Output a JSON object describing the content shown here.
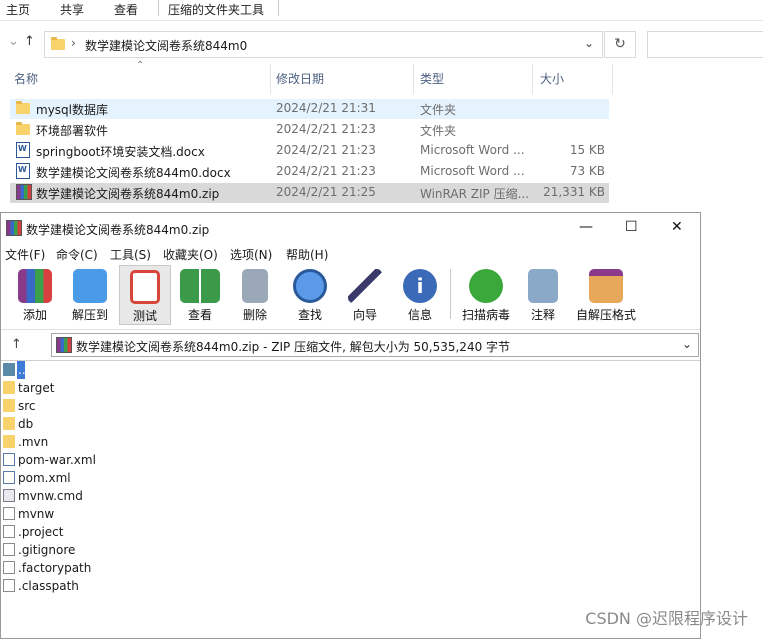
{
  "explorer": {
    "ribbon_tabs": [
      "主页",
      "共享",
      "查看",
      "压缩的文件夹工具"
    ],
    "breadcrumb": "数学建模论文阅卷系统844m0",
    "columns": {
      "name": "名称",
      "date": "修改日期",
      "type": "类型",
      "size": "大小"
    },
    "files": [
      {
        "name": "mysql数据库",
        "date": "2024/2/21 21:31",
        "type": "文件夹",
        "size": "",
        "icon": "folder-icon"
      },
      {
        "name": "环境部署软件",
        "date": "2024/2/21 21:23",
        "type": "文件夹",
        "size": "",
        "icon": "folder-icon"
      },
      {
        "name": "springboot环境安装文档.docx",
        "date": "2024/2/21 21:23",
        "type": "Microsoft Word ...",
        "size": "15 KB",
        "icon": "word-icon"
      },
      {
        "name": "数学建模论文阅卷系统844m0.docx",
        "date": "2024/2/21 21:23",
        "type": "Microsoft Word ...",
        "size": "73 KB",
        "icon": "word-icon"
      },
      {
        "name": "数学建模论文阅卷系统844m0.zip",
        "date": "2024/2/21 21:25",
        "type": "WinRAR ZIP 压缩...",
        "size": "21,331 KB",
        "icon": "winrar-icon"
      }
    ]
  },
  "winrar": {
    "title": "数学建模论文阅卷系统844m0.zip",
    "controls": {
      "minimize": "—",
      "maximize": "☐",
      "close": "✕"
    },
    "menu": [
      "文件(F)",
      "命令(C)",
      "工具(S)",
      "收藏夹(O)",
      "选项(N)",
      "帮助(H)"
    ],
    "toolbar": [
      {
        "label": "添加",
        "icon": "add-archive-icon",
        "color": "#c84a3a"
      },
      {
        "label": "解压到",
        "icon": "extract-folder-icon",
        "color": "#3a8ad8"
      },
      {
        "label": "测试",
        "icon": "test-clipboard-icon",
        "color": "#d8453a"
      },
      {
        "label": "查看",
        "icon": "view-book-icon",
        "color": "#3a9a4a"
      },
      {
        "label": "删除",
        "icon": "trash-icon",
        "color": "#7a8a9a"
      },
      {
        "label": "查找",
        "icon": "magnifier-icon",
        "color": "#3a7ac8"
      },
      {
        "label": "向导",
        "icon": "wizard-wand-icon",
        "color": "#8a6ad8"
      },
      {
        "label": "信息",
        "icon": "info-icon",
        "color": "#3a6ab8"
      },
      {
        "label": "扫描病毒",
        "icon": "virus-scan-icon",
        "color": "#3aa83a"
      },
      {
        "label": "注释",
        "icon": "comment-icon",
        "color": "#5a7a9a"
      },
      {
        "label": "自解压格式",
        "icon": "sfx-box-icon",
        "color": "#d8883a"
      }
    ],
    "path": "数学建模论文阅卷系统844m0.zip - ZIP 压缩文件, 解包大小为 50,535,240 字节",
    "entries": [
      {
        "name": "..",
        "kind": "up"
      },
      {
        "name": "target",
        "kind": "folder"
      },
      {
        "name": "src",
        "kind": "folder"
      },
      {
        "name": "db",
        "kind": "folder"
      },
      {
        "name": ".mvn",
        "kind": "folder"
      },
      {
        "name": "pom-war.xml",
        "kind": "xml"
      },
      {
        "name": "pom.xml",
        "kind": "xml"
      },
      {
        "name": "mvnw.cmd",
        "kind": "cmd"
      },
      {
        "name": "mvnw",
        "kind": "file"
      },
      {
        "name": ".project",
        "kind": "file"
      },
      {
        "name": ".gitignore",
        "kind": "file"
      },
      {
        "name": ".factorypath",
        "kind": "file"
      },
      {
        "name": ".classpath",
        "kind": "file"
      }
    ]
  },
  "watermark": "CSDN @迟限程序设计"
}
